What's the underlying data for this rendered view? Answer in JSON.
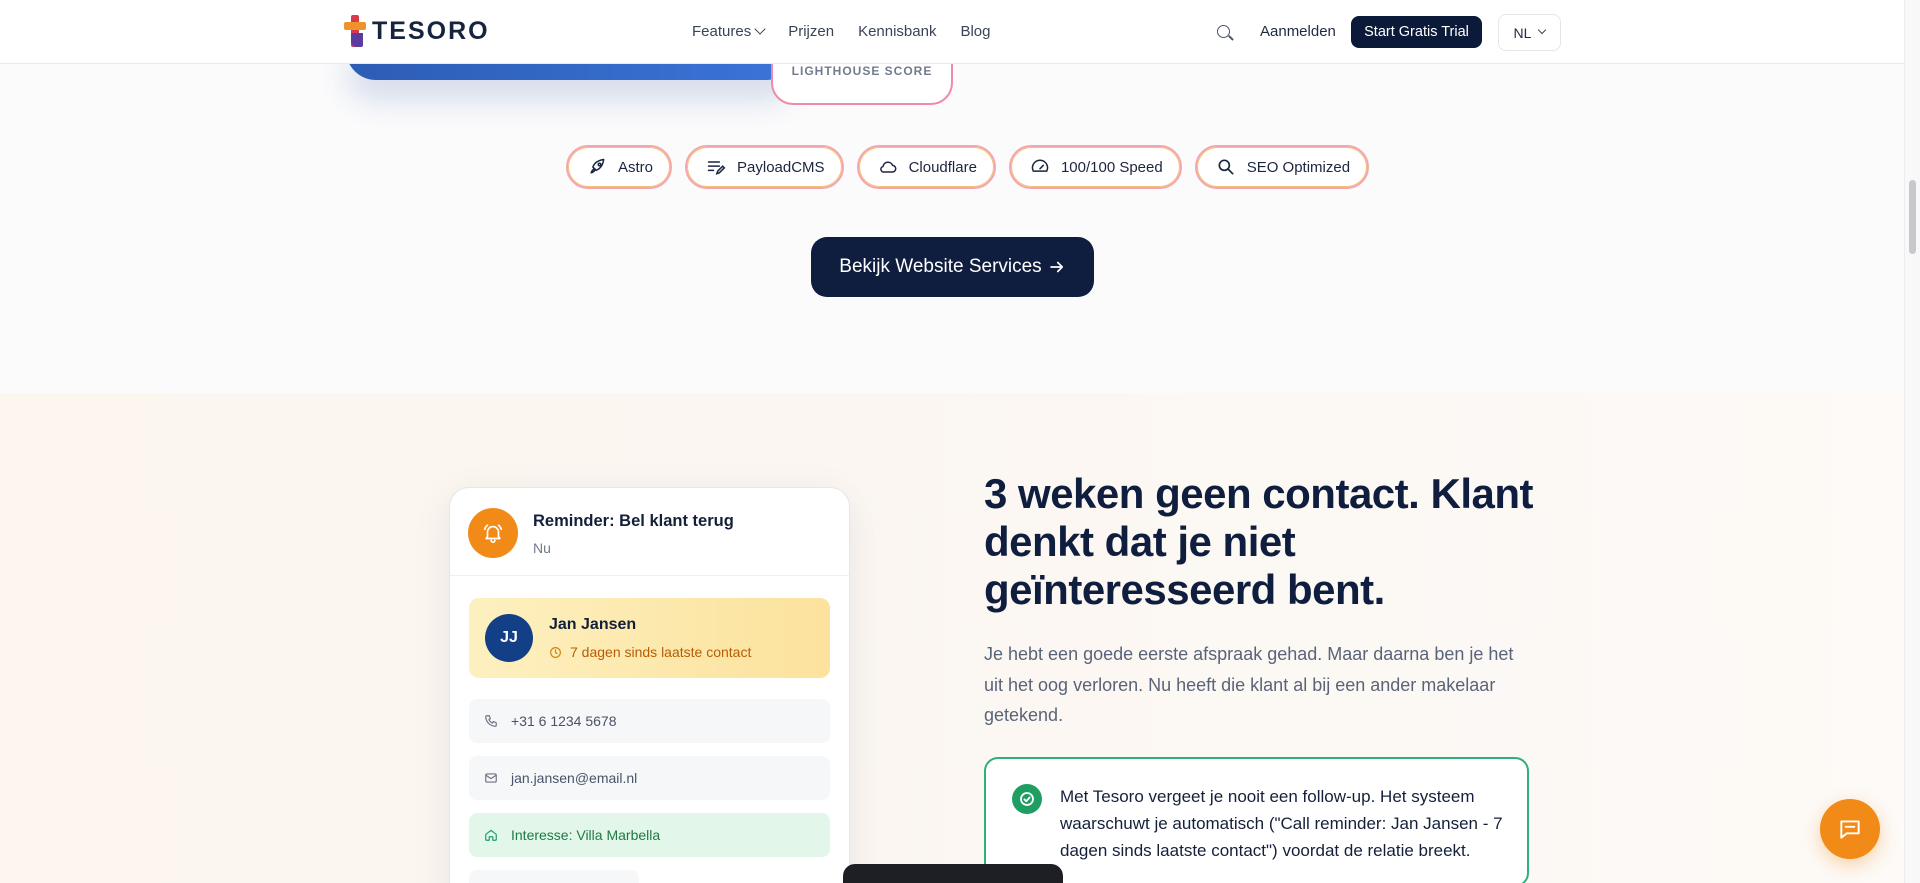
{
  "header": {
    "brand": "TESORO",
    "nav": [
      {
        "label": "Features",
        "has_dropdown": true
      },
      {
        "label": "Prijzen"
      },
      {
        "label": "Kennisbank"
      },
      {
        "label": "Blog"
      }
    ],
    "search_icon": "search-icon",
    "login_label": "Aanmelden",
    "trial_label": "Start Gratis Trial",
    "language": "NL"
  },
  "hero": {
    "score_label": "LIGHTHOUSE SCORE"
  },
  "chips": [
    {
      "label": "Astro",
      "icon": "rocket-icon"
    },
    {
      "label": "PayloadCMS",
      "icon": "edit-lines-icon"
    },
    {
      "label": "Cloudflare",
      "icon": "cloud-icon"
    },
    {
      "label": "100/100 Speed",
      "icon": "gauge-icon"
    },
    {
      "label": "SEO Optimized",
      "icon": "search-icon"
    }
  ],
  "cta": {
    "label": "Bekijk Website Services"
  },
  "reminder": {
    "title": "Reminder: Bel klant terug",
    "time": "Nu",
    "contact": {
      "initials": "JJ",
      "name": "Jan Jansen",
      "days": "7 dagen sinds laatste contact"
    },
    "phone": "+31 6 1234 5678",
    "email": "jan.jansen@email.nl",
    "interest": "Interesse: Villa Marbella"
  },
  "section": {
    "heading": "3 weken geen contact. Klant denkt dat je niet geïnteresseerd bent.",
    "paragraph": "Je hebt een goede eerste afspraak gehad. Maar daarna ben je het uit het oog verloren. Nu heeft die klant al bij een ander makelaar getekend.",
    "callout": "Met Tesoro vergeet je nooit een follow-up. Het systeem waarschuwt je automatisch (\"Call reminder: Jan Jansen - 7 dagen sinds laatste contact\") voordat de relatie breekt."
  },
  "colors": {
    "navy": "#0f1e3e",
    "orange": "#f28a18",
    "green": "#1f9e62"
  }
}
